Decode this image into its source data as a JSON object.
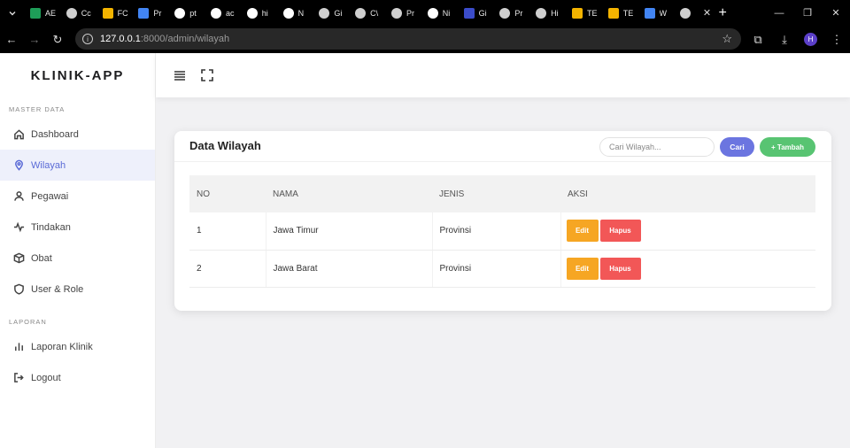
{
  "browser": {
    "tabs": [
      {
        "title": "AE",
        "icon": "sheets-icon",
        "color": "#1e9d58"
      },
      {
        "title": "Cc",
        "icon": "globe-icon",
        "color": "#cfcfcf"
      },
      {
        "title": "FC",
        "icon": "drive-icon",
        "color": "#f4b400"
      },
      {
        "title": "Pr",
        "icon": "docs-icon",
        "color": "#4285f4"
      },
      {
        "title": "pt",
        "icon": "google-icon",
        "color": "#ffffff"
      },
      {
        "title": "ac",
        "icon": "google-icon",
        "color": "#ffffff"
      },
      {
        "title": "hi",
        "icon": "github-icon",
        "color": "#ffffff"
      },
      {
        "title": "N",
        "icon": "google-icon",
        "color": "#ffffff"
      },
      {
        "title": "Gi",
        "icon": "globe-icon",
        "color": "#cfcfcf"
      },
      {
        "title": "C\\",
        "icon": "globe-icon",
        "color": "#cfcfcf"
      },
      {
        "title": "Pr",
        "icon": "globe-icon",
        "color": "#cfcfcf"
      },
      {
        "title": "Ni",
        "icon": "github-icon",
        "color": "#ffffff"
      },
      {
        "title": "Gi",
        "icon": "app-icon",
        "color": "#3b4cca"
      },
      {
        "title": "Pr",
        "icon": "globe-icon",
        "color": "#cfcfcf"
      },
      {
        "title": "Hi",
        "icon": "globe-icon",
        "color": "#cfcfcf"
      },
      {
        "title": "TE",
        "icon": "drive-icon",
        "color": "#f4b400"
      },
      {
        "title": "TE",
        "icon": "drive-icon",
        "color": "#f4b400"
      },
      {
        "title": "W",
        "icon": "docs-icon",
        "color": "#4285f4"
      },
      {
        "title": "",
        "icon": "globe-icon",
        "color": "#cfcfcf",
        "active": true
      }
    ],
    "url_host": "127.0.0.1",
    "url_path": ":8000/admin/wilayah",
    "profile_initial": "H"
  },
  "sidebar": {
    "brand": "KLINIK-APP",
    "section_master": "MASTER DATA",
    "items": [
      {
        "label": "Dashboard",
        "icon": "home-icon"
      },
      {
        "label": "Wilayah",
        "icon": "map-pin-icon",
        "active": true
      },
      {
        "label": "Pegawai",
        "icon": "user-icon"
      },
      {
        "label": "Tindakan",
        "icon": "activity-icon"
      },
      {
        "label": "Obat",
        "icon": "box-icon"
      },
      {
        "label": "User & Role",
        "icon": "shield-icon"
      }
    ],
    "section_report": "LAPORAN",
    "report_items": [
      {
        "label": "Laporan Klinik",
        "icon": "bar-chart-icon"
      },
      {
        "label": "Logout",
        "icon": "logout-icon"
      }
    ]
  },
  "main": {
    "card_title": "Data Wilayah",
    "search_placeholder": "Cari Wilayah...",
    "search_button": "Cari",
    "add_button": "+ Tambah",
    "columns": [
      "NO",
      "NAMA",
      "JENIS",
      "AKSI"
    ],
    "rows": [
      {
        "no": "1",
        "nama": "Jawa Timur",
        "jenis": "Provinsi"
      },
      {
        "no": "2",
        "nama": "Jawa Barat",
        "jenis": "Provinsi"
      }
    ],
    "edit_label": "Edit",
    "delete_label": "Hapus"
  }
}
